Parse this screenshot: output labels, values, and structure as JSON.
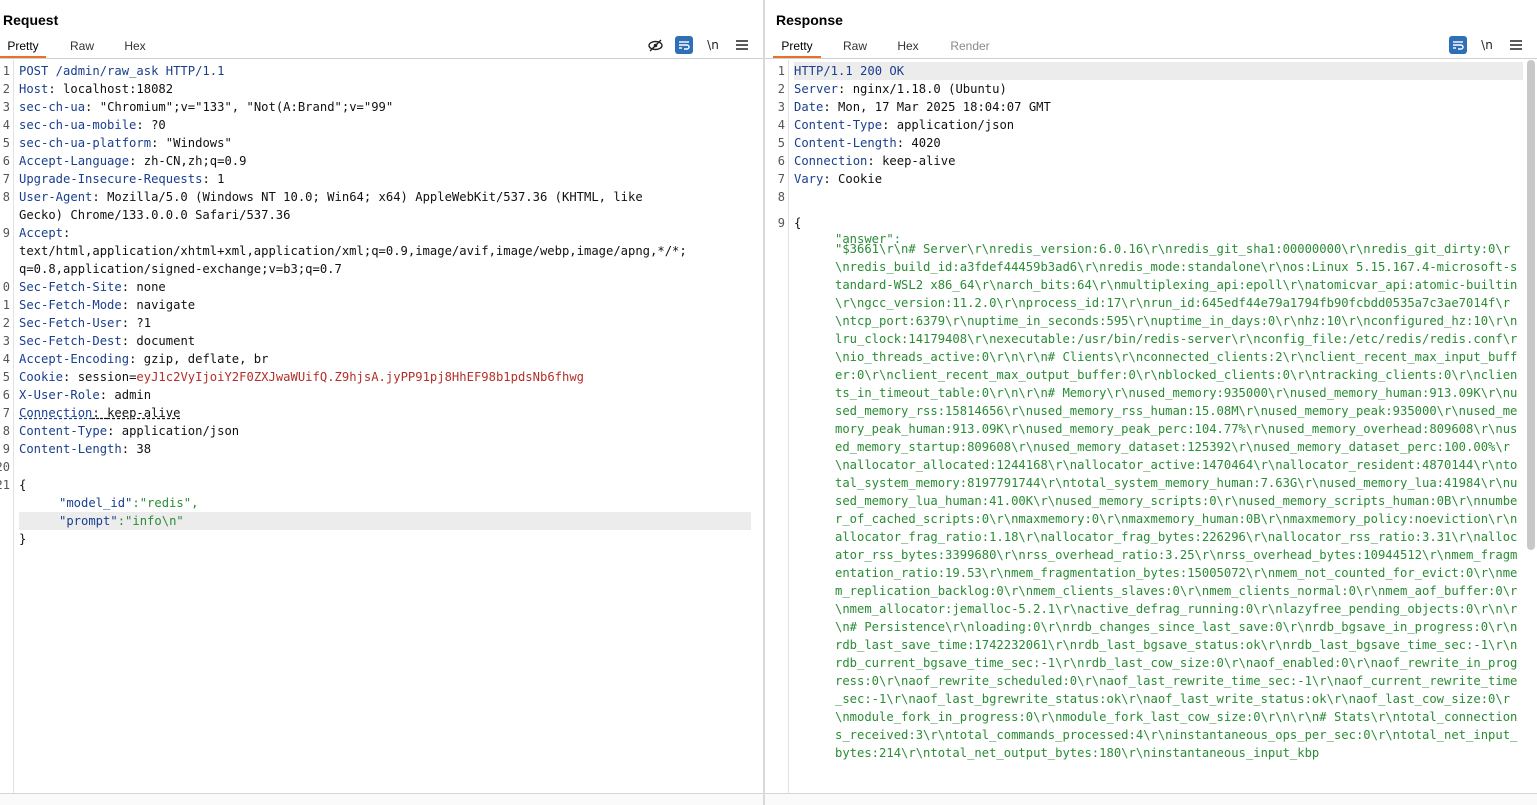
{
  "request": {
    "title": "Request",
    "tabs": [
      "Pretty",
      "Raw",
      "Hex"
    ],
    "active_tab": "Pretty",
    "toolbar_icons": [
      "eye-off-icon",
      "wrap-icon",
      "newline-icon",
      "menu-icon"
    ],
    "newline_label": "\\n",
    "lines": [
      {
        "n": "1",
        "key": "POST /admin/raw_ask HTTP/1.1",
        "val": ""
      },
      {
        "n": "2",
        "key": "Host",
        "val": "localhost:18082"
      },
      {
        "n": "3",
        "key": "sec-ch-ua",
        "val": "\"Chromium\";v=\"133\", \"Not(A:Brand\";v=\"99\""
      },
      {
        "n": "4",
        "key": "sec-ch-ua-mobile",
        "val": "?0"
      },
      {
        "n": "5",
        "key": "sec-ch-ua-platform",
        "val": "\"Windows\""
      },
      {
        "n": "6",
        "key": "Accept-Language",
        "val": "zh-CN,zh;q=0.9"
      },
      {
        "n": "7",
        "key": "Upgrade-Insecure-Requests",
        "val": "1"
      },
      {
        "n": "8",
        "key": "User-Agent",
        "val": "Mozilla/5.0 (Windows NT 10.0; Win64; x64) AppleWebKit/537.36 (KHTML, like"
      },
      {
        "n": "",
        "key": "",
        "val": "Gecko) Chrome/133.0.0.0 Safari/537.36"
      },
      {
        "n": "9",
        "key": "Accept",
        "val": ""
      },
      {
        "n": "",
        "key": "",
        "val": "text/html,application/xhtml+xml,application/xml;q=0.9,image/avif,image/webp,image/apng,*/*;"
      },
      {
        "n": "",
        "key": "",
        "val": "q=0.8,application/signed-exchange;v=b3;q=0.7"
      },
      {
        "n": "0",
        "key": "Sec-Fetch-Site",
        "val": "none"
      },
      {
        "n": "1",
        "key": "Sec-Fetch-Mode",
        "val": "navigate"
      },
      {
        "n": "2",
        "key": "Sec-Fetch-User",
        "val": "?1"
      },
      {
        "n": "3",
        "key": "Sec-Fetch-Dest",
        "val": "document"
      },
      {
        "n": "4",
        "key": "Accept-Encoding",
        "val": "gzip, deflate, br"
      },
      {
        "n": "5",
        "key": "Cookie",
        "val": "session=",
        "cookie": "eyJ1c2VyIjoiY2F0ZXJwaWUifQ.Z9hjsA.jyPP91pj8HhEF98b1pdsNb6fhwg"
      },
      {
        "n": "6",
        "key": "X-User-Role",
        "val": "admin"
      },
      {
        "n": "7",
        "key": "Connection",
        "val": "keep-alive"
      },
      {
        "n": "8",
        "key": "Content-Type",
        "val": "application/json"
      },
      {
        "n": "9",
        "key": "Content-Length",
        "val": "38"
      },
      {
        "n": "20",
        "key": "",
        "val": ""
      },
      {
        "n": "21",
        "key": "",
        "val": "{"
      },
      {
        "n": "",
        "key": "\"model_id\"",
        "val": ":\"redis\",",
        "json": true
      },
      {
        "n": "",
        "key": "\"prompt\"",
        "val": ":\"info\\n\"",
        "json": true
      },
      {
        "n": "",
        "key": "",
        "val": "}"
      }
    ]
  },
  "response": {
    "title": "Response",
    "tabs": [
      "Pretty",
      "Raw",
      "Hex",
      "Render"
    ],
    "active_tab": "Pretty",
    "disabled_tab": "Render",
    "toolbar_icons": [
      "wrap-icon",
      "newline-icon",
      "menu-icon"
    ],
    "newline_label": "\\n",
    "headers": [
      {
        "n": "1",
        "key": "HTTP/1.1 200 OK",
        "val": ""
      },
      {
        "n": "2",
        "key": "Server",
        "val": "nginx/1.18.0 (Ubuntu)"
      },
      {
        "n": "3",
        "key": "Date",
        "val": "Mon, 17 Mar 2025 18:04:07 GMT"
      },
      {
        "n": "4",
        "key": "Content-Type",
        "val": "application/json"
      },
      {
        "n": "5",
        "key": "Content-Length",
        "val": "4020"
      },
      {
        "n": "6",
        "key": "Connection",
        "val": "keep-alive"
      },
      {
        "n": "7",
        "key": "Vary",
        "val": "Cookie"
      },
      {
        "n": "8",
        "key": "",
        "val": ""
      },
      {
        "n": "9",
        "key": "",
        "val": "{"
      }
    ],
    "answer_key": "\"answer\":",
    "answer_value": "\"$3661\\r\\n# Server\\r\\nredis_version:6.0.16\\r\\nredis_git_sha1:00000000\\r\\nredis_git_dirty:0\\r\\nredis_build_id:a3fdef44459b3ad6\\r\\nredis_mode:standalone\\r\\nos:Linux 5.15.167.4-microsoft-standard-WSL2 x86_64\\r\\narch_bits:64\\r\\nmultiplexing_api:epoll\\r\\natomicvar_api:atomic-builtin\\r\\ngcc_version:11.2.0\\r\\nprocess_id:17\\r\\nrun_id:645edf44e79a1794fb90fcbdd0535a7c3ae7014f\\r\\ntcp_port:6379\\r\\nuptime_in_seconds:595\\r\\nuptime_in_days:0\\r\\nhz:10\\r\\nconfigured_hz:10\\r\\nlru_clock:14179408\\r\\nexecutable:/usr/bin/redis-server\\r\\nconfig_file:/etc/redis/redis.conf\\r\\nio_threads_active:0\\r\\n\\r\\n# Clients\\r\\nconnected_clients:2\\r\\nclient_recent_max_input_buffer:0\\r\\nclient_recent_max_output_buffer:0\\r\\nblocked_clients:0\\r\\ntracking_clients:0\\r\\nclients_in_timeout_table:0\\r\\n\\r\\n# Memory\\r\\nused_memory:935000\\r\\nused_memory_human:913.09K\\r\\nused_memory_rss:15814656\\r\\nused_memory_rss_human:15.08M\\r\\nused_memory_peak:935000\\r\\nused_memory_peak_human:913.09K\\r\\nused_memory_peak_perc:104.77%\\r\\nused_memory_overhead:809608\\r\\nused_memory_startup:809608\\r\\nused_memory_dataset:125392\\r\\nused_memory_dataset_perc:100.00%\\r\\nallocator_allocated:1244168\\r\\nallocator_active:1470464\\r\\nallocator_resident:4870144\\r\\ntotal_system_memory:8197791744\\r\\ntotal_system_memory_human:7.63G\\r\\nused_memory_lua:41984\\r\\nused_memory_lua_human:41.00K\\r\\nused_memory_scripts:0\\r\\nused_memory_scripts_human:0B\\r\\nnumber_of_cached_scripts:0\\r\\nmaxmemory:0\\r\\nmaxmemory_human:0B\\r\\nmaxmemory_policy:noeviction\\r\\nallocator_frag_ratio:1.18\\r\\nallocator_frag_bytes:226296\\r\\nallocator_rss_ratio:3.31\\r\\nallocator_rss_bytes:3399680\\r\\nrss_overhead_ratio:3.25\\r\\nrss_overhead_bytes:10944512\\r\\nmem_fragmentation_ratio:19.53\\r\\nmem_fragmentation_bytes:15005072\\r\\nmem_not_counted_for_evict:0\\r\\nmem_replication_backlog:0\\r\\nmem_clients_slaves:0\\r\\nmem_clients_normal:0\\r\\nmem_aof_buffer:0\\r\\nmem_allocator:jemalloc-5.2.1\\r\\nactive_defrag_running:0\\r\\nlazyfree_pending_objects:0\\r\\n\\r\\n# Persistence\\r\\nloading:0\\r\\nrdb_changes_since_last_save:0\\r\\nrdb_bgsave_in_progress:0\\r\\nrdb_last_save_time:1742232061\\r\\nrdb_last_bgsave_status:ok\\r\\nrdb_last_bgsave_time_sec:-1\\r\\nrdb_current_bgsave_time_sec:-1\\r\\nrdb_last_cow_size:0\\r\\naof_enabled:0\\r\\naof_rewrite_in_progress:0\\r\\naof_rewrite_scheduled:0\\r\\naof_last_rewrite_time_sec:-1\\r\\naof_current_rewrite_time_sec:-1\\r\\naof_last_bgrewrite_status:ok\\r\\naof_last_write_status:ok\\r\\naof_last_cow_size:0\\r\\nmodule_fork_in_progress:0\\r\\nmodule_fork_last_cow_size:0\\r\\n\\r\\n# Stats\\r\\ntotal_connections_received:3\\r\\ntotal_commands_processed:4\\r\\ninstantaneous_ops_per_sec:0\\r\\ntotal_net_input_bytes:214\\r\\ntotal_net_output_bytes:180\\r\\ninstantaneous_input_kbp"
  },
  "colors": {
    "accent": "#e8702a",
    "header_key": "#1a3f8e",
    "cookie_value": "#b2302a",
    "json_green": "#2a8c35",
    "button_blue": "#2f6fb7"
  }
}
